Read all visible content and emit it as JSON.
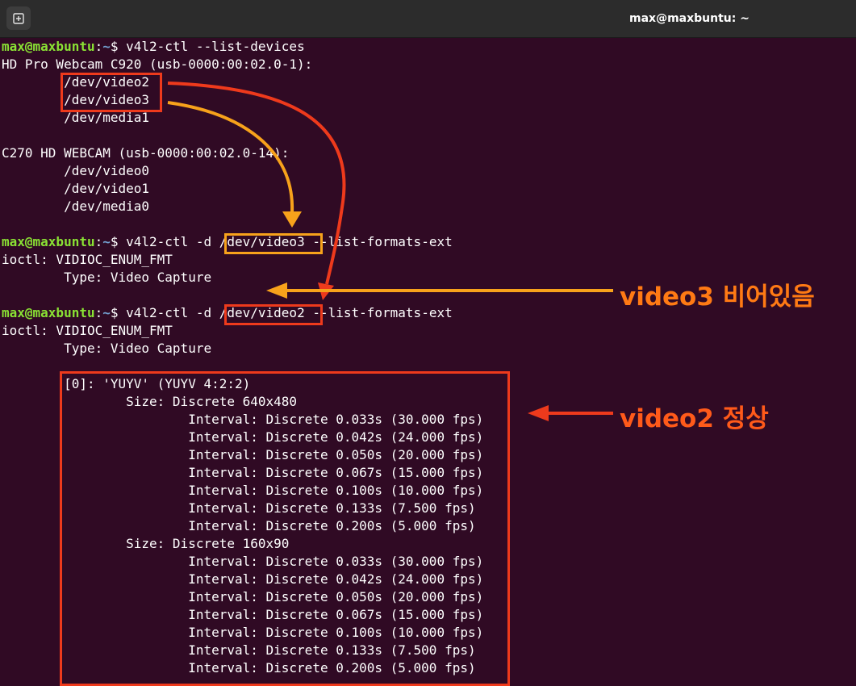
{
  "window": {
    "title": "max@maxbuntu: ~",
    "new_tab_icon": "new-tab-icon"
  },
  "terminal": {
    "prompt": {
      "user": "max@maxbuntu",
      "colon": ":",
      "dir": "~",
      "symbol": "$ "
    },
    "lines": [
      {
        "type": "prompt",
        "cmd": "v4l2-ctl --list-devices"
      },
      {
        "type": "out",
        "text": "HD Pro Webcam C920 (usb-0000:00:02.0-1):"
      },
      {
        "type": "out",
        "text": "        /dev/video2"
      },
      {
        "type": "out",
        "text": "        /dev/video3"
      },
      {
        "type": "out",
        "text": "        /dev/media1"
      },
      {
        "type": "out",
        "text": ""
      },
      {
        "type": "out",
        "text": "C270 HD WEBCAM (usb-0000:00:02.0-14):"
      },
      {
        "type": "out",
        "text": "        /dev/video0"
      },
      {
        "type": "out",
        "text": "        /dev/video1"
      },
      {
        "type": "out",
        "text": "        /dev/media0"
      },
      {
        "type": "out",
        "text": ""
      },
      {
        "type": "prompt",
        "cmd": "v4l2-ctl -d /dev/video3 --list-formats-ext"
      },
      {
        "type": "out",
        "text": "ioctl: VIDIOC_ENUM_FMT"
      },
      {
        "type": "out",
        "text": "        Type: Video Capture"
      },
      {
        "type": "out",
        "text": ""
      },
      {
        "type": "prompt",
        "cmd": "v4l2-ctl -d /dev/video2 --list-formats-ext"
      },
      {
        "type": "out",
        "text": "ioctl: VIDIOC_ENUM_FMT"
      },
      {
        "type": "out",
        "text": "        Type: Video Capture"
      },
      {
        "type": "out",
        "text": ""
      },
      {
        "type": "out",
        "text": "        [0]: 'YUYV' (YUYV 4:2:2)"
      },
      {
        "type": "out",
        "text": "                Size: Discrete 640x480"
      },
      {
        "type": "out",
        "text": "                        Interval: Discrete 0.033s (30.000 fps)"
      },
      {
        "type": "out",
        "text": "                        Interval: Discrete 0.042s (24.000 fps)"
      },
      {
        "type": "out",
        "text": "                        Interval: Discrete 0.050s (20.000 fps)"
      },
      {
        "type": "out",
        "text": "                        Interval: Discrete 0.067s (15.000 fps)"
      },
      {
        "type": "out",
        "text": "                        Interval: Discrete 0.100s (10.000 fps)"
      },
      {
        "type": "out",
        "text": "                        Interval: Discrete 0.133s (7.500 fps)"
      },
      {
        "type": "out",
        "text": "                        Interval: Discrete 0.200s (5.000 fps)"
      },
      {
        "type": "out",
        "text": "                Size: Discrete 160x90"
      },
      {
        "type": "out",
        "text": "                        Interval: Discrete 0.033s (30.000 fps)"
      },
      {
        "type": "out",
        "text": "                        Interval: Discrete 0.042s (24.000 fps)"
      },
      {
        "type": "out",
        "text": "                        Interval: Discrete 0.050s (20.000 fps)"
      },
      {
        "type": "out",
        "text": "                        Interval: Discrete 0.067s (15.000 fps)"
      },
      {
        "type": "out",
        "text": "                        Interval: Discrete 0.100s (10.000 fps)"
      },
      {
        "type": "out",
        "text": "                        Interval: Discrete 0.133s (7.500 fps)"
      },
      {
        "type": "out",
        "text": "                        Interval: Discrete 0.200s (5.000 fps)"
      }
    ]
  },
  "annotations": {
    "video3_label": "video3 비어있음",
    "video2_label": "video2 정상",
    "red_color": "#ee3a1c",
    "orange_color": "#f7a21b",
    "label_color": "#ff7a14"
  }
}
